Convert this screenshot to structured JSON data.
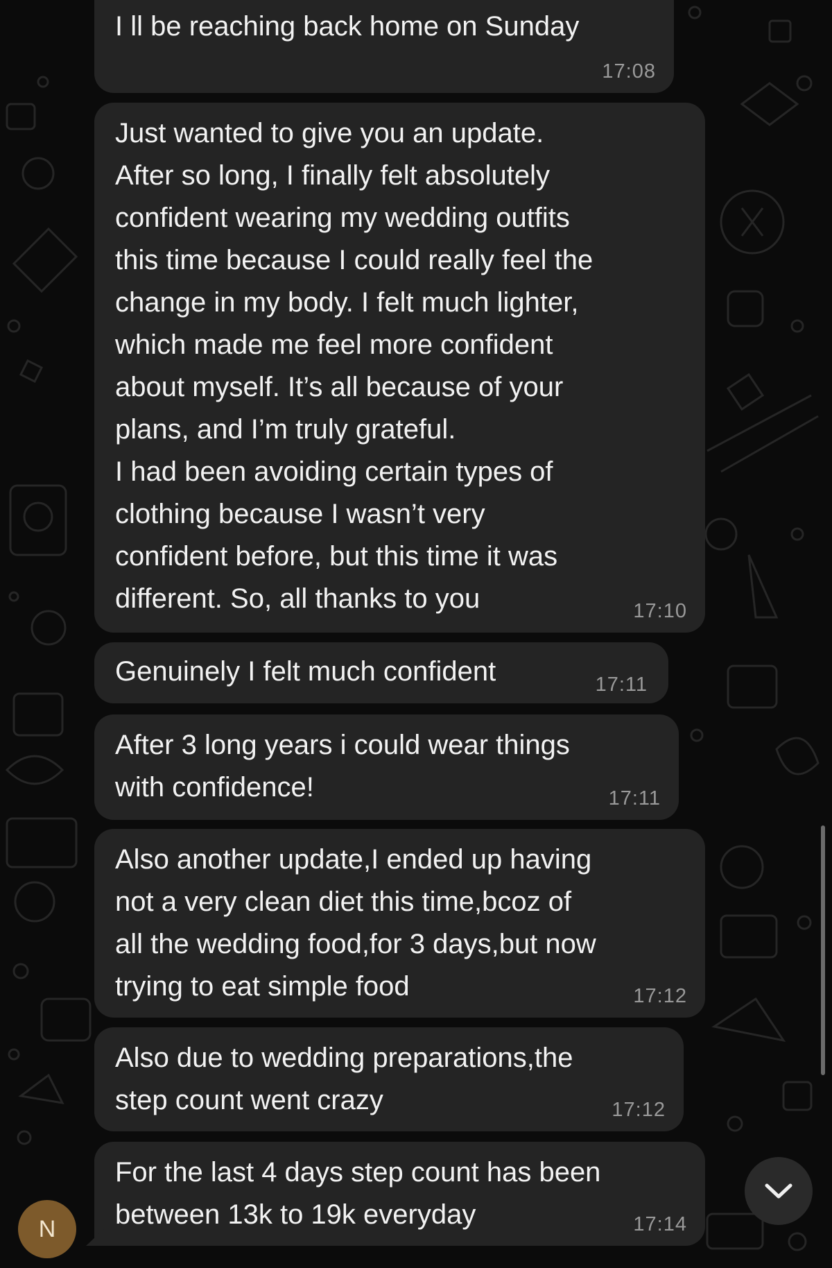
{
  "chat": {
    "contact_initial": "N",
    "messages": [
      {
        "text": "I ll be reaching back home on Sunday",
        "time": "17:08"
      },
      {
        "text": "Just wanted to give you an update.\nAfter so long, I finally felt absolutely\nconfident wearing my wedding outfits\nthis time because I could really feel the\nchange in my body. I felt much lighter,\nwhich made me feel more confident\nabout myself. It’s all because of your\nplans, and I’m truly grateful.\nI had been avoiding certain types of\nclothing because I wasn’t very\nconfident before, but this time it was\ndifferent. So, all thanks to you",
        "time": "17:10"
      },
      {
        "text": "Genuinely I felt much confident",
        "time": "17:11"
      },
      {
        "text": "After 3 long years i could wear things\nwith confidence!",
        "time": "17:11"
      },
      {
        "text": "Also another update,I ended up having\nnot a very clean diet this time,bcoz of\nall the wedding food,for 3 days,but now\ntrying to eat simple food",
        "time": "17:12"
      },
      {
        "text": "Also due to wedding preparations,the\nstep count went crazy",
        "time": "17:12"
      },
      {
        "text": "For the last 4 days step count has been\nbetween 13k to 19k everyday",
        "time": "17:14"
      }
    ]
  },
  "icons": {
    "scroll_down": "chevron-down-icon"
  },
  "colors": {
    "background": "#0b0b0b",
    "bubble": "#242424",
    "text": "#f2f2f2",
    "timestamp": "#9a9a9a",
    "avatar": "#7d5a2b"
  }
}
